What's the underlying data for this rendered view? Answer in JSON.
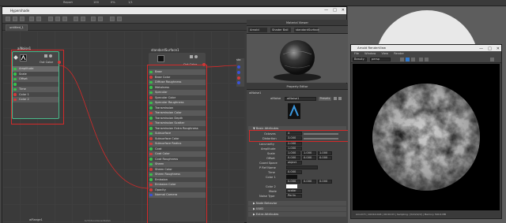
{
  "top_strip": {
    "items": [
      "Report",
      "100",
      "0%",
      "1/1"
    ]
  },
  "hypershade": {
    "title": "Hypershade",
    "tab": "untitled_1",
    "graph_label": "aiRange1",
    "graph_hint": "tuTInfocoOwnerDeta1"
  },
  "noise_node": {
    "name": "aiNoise1",
    "out_label": "Out Color",
    "attrs": [
      "Amplitude",
      "Scale",
      "Offset",
      "Time",
      "Color 1",
      "Color 2"
    ]
  },
  "surface_node": {
    "name": "standardSurface1",
    "out_label": "Out Color",
    "attrs": [
      "Base",
      "Base Color",
      "Diffuse Roughness",
      "Metalness",
      "Specular",
      "Specular Color",
      "Specular Roughness",
      "Transmission",
      "Transmission Color",
      "Transmission Depth",
      "Transmission Scatter",
      "Transmission Extra Roughness",
      "Subsurface",
      "Subsurface Color",
      "Subsurface Radius",
      "Coat",
      "Coat Color",
      "Coat Roughness",
      "Sheen",
      "Sheen Color",
      "Sheen Roughness",
      "Emission",
      "Emission Color",
      "Opacity",
      "Normal Camera"
    ],
    "sg_label": "sta"
  },
  "material_viewer": {
    "title": "Material Viewer",
    "renderer": "Arnold",
    "shape": "Shader Ball",
    "mode": "standardSurface"
  },
  "property_editor": {
    "title": "Property Editor",
    "node_tab": "aiNoise1",
    "type_label": "aiNoise",
    "node_field": "aiNoise1",
    "presets_label": "Presets",
    "section_basic": "Basic Attributes",
    "octaves_label": "Octaves",
    "octaves_value": "4",
    "distortion_label": "Distortion",
    "distortion_value": "3.000",
    "lacunarity_label": "Lacunarity",
    "lacunarity_value": "2.000",
    "amplitude_label": "Amplitude",
    "amplitude_value": "1.000",
    "scale_label": "Scale",
    "scale_values": [
      "1.000",
      "1.000",
      "1.000"
    ],
    "offset_label": "Offset",
    "offset_values": [
      "0.000",
      "0.000",
      "0.000"
    ],
    "coord_label": "Coord Space",
    "coord_value": "object",
    "pref_label": "P Ref Name",
    "time_label": "Time",
    "time_value": "0.000",
    "color1_label": "Color 1",
    "color2_label": "Color 2",
    "color_values": [
      "0.000",
      "0.000",
      "0.000"
    ],
    "mode_label": "Mode",
    "mode_value": "scalar",
    "noise_type_label": "Noise Type",
    "noise_type_value": "Perlin",
    "sections_closed": [
      "Node Behavior",
      "UUID",
      "Extra Attributes"
    ]
  },
  "render_view": {
    "title": "Arnold RenderView",
    "menu": [
      "File",
      "Window",
      "View",
      "Render"
    ],
    "camera": "persp",
    "aov": "Beauty",
    "status": "Arnold 5 | 1024x1024 | 00:00:03 | Sampling: [3/2/2/2/2] | Memory 500.6 MB"
  },
  "colors": {
    "accent_red": "#d42a2a",
    "port_green": "#39c24a",
    "port_red": "#d23b3b",
    "port_blue": "#3a52d8"
  }
}
